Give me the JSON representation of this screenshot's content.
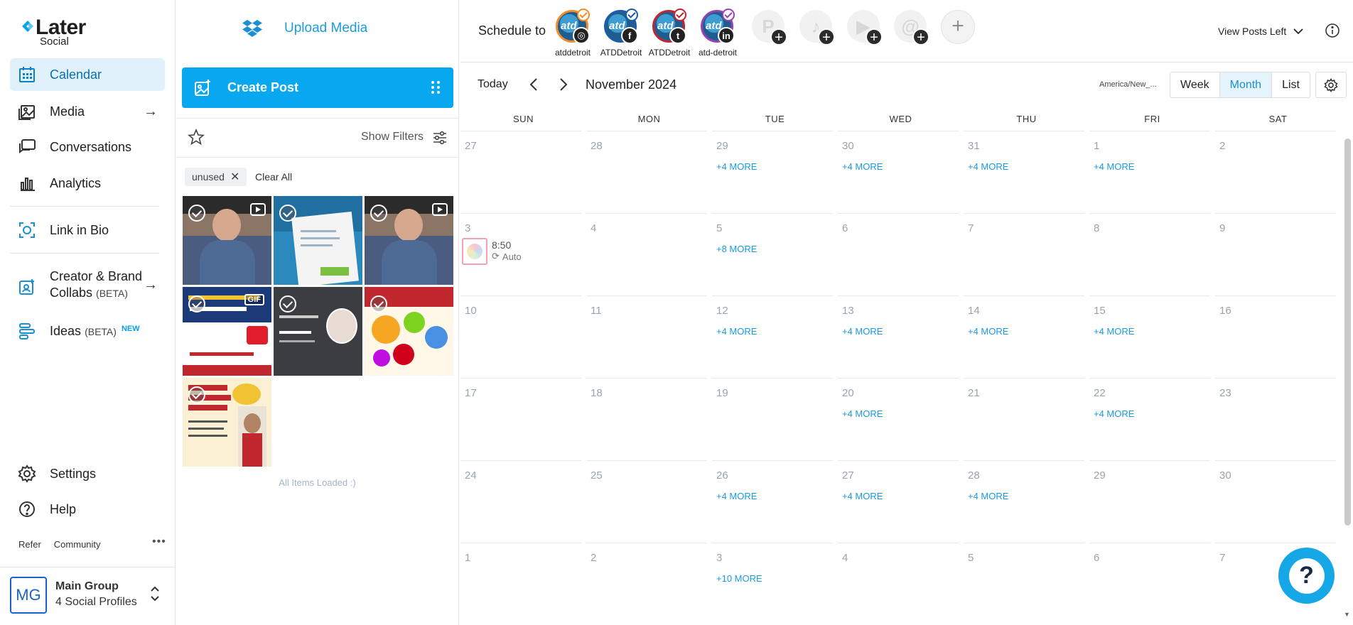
{
  "brand": {
    "name": "Later",
    "sub": "Social"
  },
  "nav": {
    "items": [
      {
        "label": "Calendar",
        "icon": "calendar-icon",
        "active": true
      },
      {
        "label": "Media",
        "icon": "media-icon"
      },
      {
        "label": "Conversations",
        "icon": "conversations-icon"
      },
      {
        "label": "Analytics",
        "icon": "analytics-icon"
      },
      {
        "label": "Link in Bio",
        "icon": "link-in-bio-icon"
      },
      {
        "label": "Creator & Brand",
        "label2": "Collabs",
        "beta": "(BETA)",
        "icon": "creator-collabs-icon"
      },
      {
        "label": "Ideas",
        "beta": "(BETA)",
        "badge": "NEW",
        "icon": "ideas-icon"
      }
    ],
    "settings": "Settings",
    "help": "Help",
    "refer": "Refer",
    "community": "Community",
    "group": {
      "initials": "MG",
      "name": "Main Group",
      "profiles": "4 Social Profiles"
    }
  },
  "media": {
    "upload": "Upload Media",
    "create_post": "Create Post",
    "show_filters": "Show Filters",
    "chip": "unused",
    "clear_all": "Clear All",
    "gif_label": "GIF",
    "all_loaded": "All Items Loaded :)"
  },
  "topbar": {
    "schedule_to": "Schedule to",
    "profiles": [
      {
        "name": "atddetroit",
        "network": "instagram",
        "ring": "#f28c28",
        "glyph": "◎"
      },
      {
        "name": "ATDDetroit",
        "network": "facebook",
        "ring": "#1c5ca8",
        "glyph": "f"
      },
      {
        "name": "ATDDetroit",
        "network": "twitter",
        "ring": "#c4232f",
        "glyph": "t"
      },
      {
        "name": "atd-detroit",
        "network": "linkedin",
        "ring": "#9b3fb5",
        "glyph": "in"
      }
    ],
    "avatar_text": "atd",
    "view_posts": "View Posts Left"
  },
  "calendar": {
    "today": "Today",
    "month": "November 2024",
    "timezone": "America/New_...",
    "views": [
      "Week",
      "Month",
      "List"
    ],
    "active_view": "Month",
    "weekdays": [
      "SUN",
      "MON",
      "TUE",
      "WED",
      "THU",
      "FRI",
      "SAT"
    ],
    "weeks": [
      [
        {
          "d": "27"
        },
        {
          "d": "28"
        },
        {
          "d": "29",
          "more": "+4 MORE"
        },
        {
          "d": "30",
          "more": "+4 MORE"
        },
        {
          "d": "31",
          "more": "+4 MORE"
        },
        {
          "d": "1",
          "more": "+4 MORE"
        },
        {
          "d": "2"
        }
      ],
      [
        {
          "d": "3",
          "post": {
            "time": "8:50",
            "mode": "Auto"
          }
        },
        {
          "d": "4"
        },
        {
          "d": "5",
          "more": "+8 MORE"
        },
        {
          "d": "6"
        },
        {
          "d": "7"
        },
        {
          "d": "8"
        },
        {
          "d": "9"
        }
      ],
      [
        {
          "d": "10"
        },
        {
          "d": "11"
        },
        {
          "d": "12",
          "more": "+4 MORE"
        },
        {
          "d": "13",
          "more": "+4 MORE"
        },
        {
          "d": "14",
          "more": "+4 MORE"
        },
        {
          "d": "15",
          "more": "+4 MORE"
        },
        {
          "d": "16"
        }
      ],
      [
        {
          "d": "17"
        },
        {
          "d": "18"
        },
        {
          "d": "19"
        },
        {
          "d": "20",
          "more": "+4 MORE"
        },
        {
          "d": "21"
        },
        {
          "d": "22",
          "more": "+4 MORE"
        },
        {
          "d": "23"
        }
      ],
      [
        {
          "d": "24"
        },
        {
          "d": "25"
        },
        {
          "d": "26",
          "more": "+4 MORE"
        },
        {
          "d": "27",
          "more": "+4 MORE"
        },
        {
          "d": "28",
          "more": "+4 MORE"
        },
        {
          "d": "29"
        },
        {
          "d": "30"
        }
      ],
      [
        {
          "d": "1"
        },
        {
          "d": "2"
        },
        {
          "d": "3",
          "more": "+10 MORE"
        },
        {
          "d": "4"
        },
        {
          "d": "5"
        },
        {
          "d": "6"
        },
        {
          "d": "7"
        }
      ]
    ]
  },
  "colors": {
    "accent": "#07a8f0",
    "link": "#1a9ae0",
    "nav_active_bg": "#e1f1fb"
  }
}
